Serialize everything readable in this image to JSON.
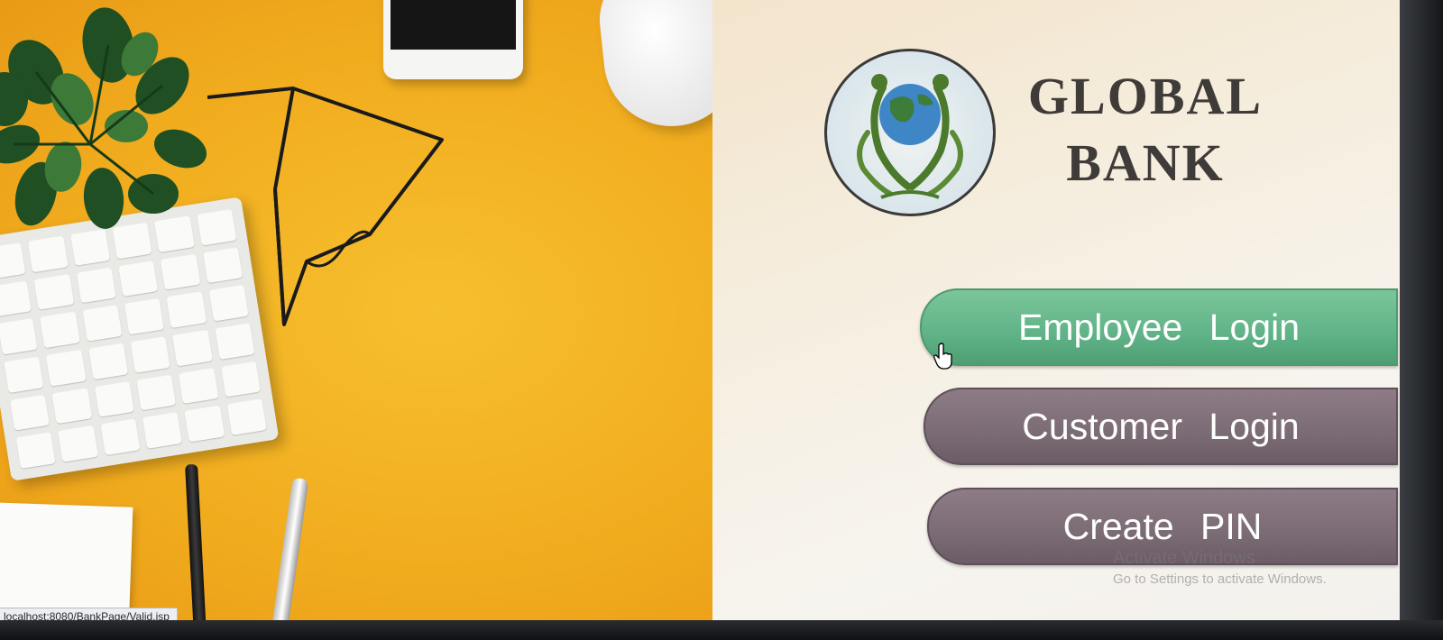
{
  "status_bar": {
    "url": "localhost:8080/BankPage/Valid.jsp"
  },
  "brand": {
    "line1": "GLOBAL",
    "line2": "BANK",
    "logo_icon": "globe-people-logo"
  },
  "buttons": {
    "employee_login": "Employee Login",
    "customer_login": "Customer Login",
    "create_pin": "Create PIN"
  },
  "watermark": {
    "title": "Activate Windows",
    "subtitle": "Go to Settings to activate Windows."
  },
  "colors": {
    "desk_yellow": "#f1ac1e",
    "employee_button": "#5fb387",
    "customer_button": "#7b6b75",
    "brand_text": "#3f3b38"
  },
  "icons": {
    "cursor": "hand-pointer-icon"
  }
}
